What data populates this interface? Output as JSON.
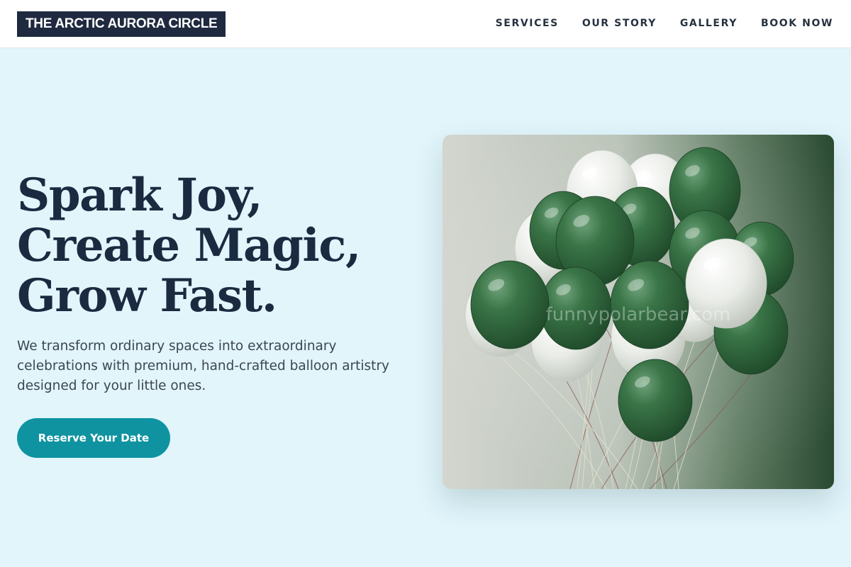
{
  "header": {
    "brand": "THE ARCTIC AURORA CIRCLE",
    "nav": [
      {
        "label": "SERVICES"
      },
      {
        "label": "OUR STORY"
      },
      {
        "label": "GALLERY"
      },
      {
        "label": "BOOK NOW"
      }
    ]
  },
  "hero": {
    "title_lines": [
      "Spark Joy,",
      "Create Magic,",
      "Grow Fast."
    ],
    "description": "We transform ordinary spaces into extraordinary celebrations with premium, hand-crafted balloon artistry designed for your little ones.",
    "cta_label": "Reserve Your Date",
    "image": {
      "watermark": "funnypolarbear.com"
    }
  },
  "colors": {
    "accent": "#0f93a1",
    "brand_bg": "#1f2a40",
    "page_bg": "#e1f5fb",
    "balloon_green": "#2f6a3f",
    "balloon_white": "#eef0ec"
  }
}
